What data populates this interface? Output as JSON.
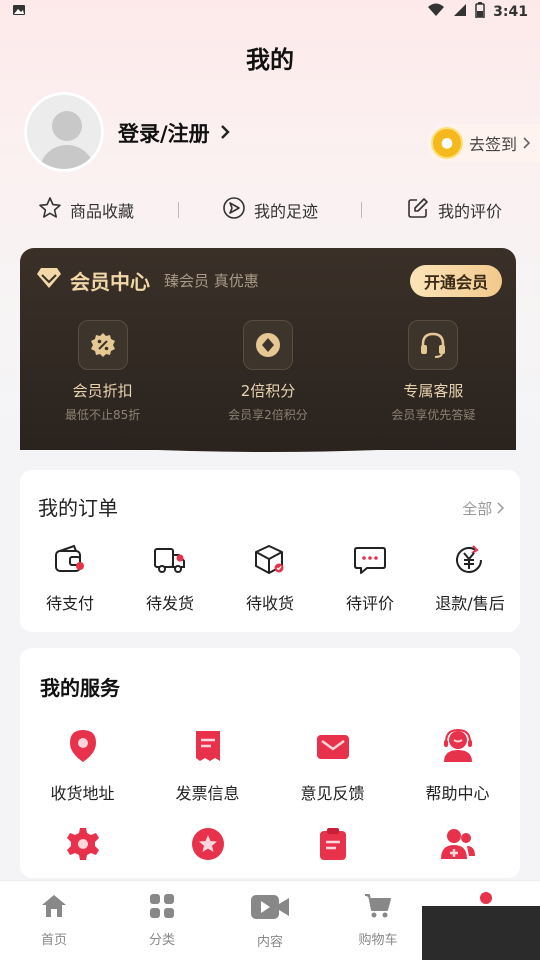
{
  "status_bar": {
    "time": "3:41"
  },
  "page_title": "我的",
  "profile": {
    "login_label": "登录/注册",
    "signin_label": "去签到"
  },
  "quick_links": [
    {
      "label": "商品收藏",
      "icon": "star-icon"
    },
    {
      "label": "我的足迹",
      "icon": "footprint-icon"
    },
    {
      "label": "我的评价",
      "icon": "edit-icon"
    }
  ],
  "vip": {
    "title": "会员中心",
    "slogan": "臻会员 真优惠",
    "open_label": "开通会员",
    "features": [
      {
        "title": "会员折扣",
        "desc": "最低不止85折",
        "icon": "discount-icon"
      },
      {
        "title": "2倍积分",
        "desc": "会员享2倍积分",
        "icon": "points-icon"
      },
      {
        "title": "专属客服",
        "desc": "会员享优先答疑",
        "icon": "headset-icon"
      }
    ],
    "colors": {
      "bg": "#2f2722",
      "gold": "#f2d7a8"
    }
  },
  "orders": {
    "title": "我的订单",
    "all_label": "全部",
    "items": [
      {
        "label": "待支付",
        "icon": "wallet-icon"
      },
      {
        "label": "待发货",
        "icon": "truck-icon"
      },
      {
        "label": "待收货",
        "icon": "package-icon"
      },
      {
        "label": "待评价",
        "icon": "comment-icon"
      },
      {
        "label": "退款/售后",
        "icon": "refund-icon"
      }
    ]
  },
  "services": {
    "title": "我的服务",
    "items": [
      {
        "label": "收货地址",
        "icon": "location-icon"
      },
      {
        "label": "发票信息",
        "icon": "invoice-icon"
      },
      {
        "label": "意见反馈",
        "icon": "mail-icon"
      },
      {
        "label": "帮助中心",
        "icon": "support-icon"
      },
      {
        "label": "",
        "icon": "settings-icon"
      },
      {
        "label": "",
        "icon": "star-badge-icon"
      },
      {
        "label": "",
        "icon": "clipboard-icon"
      },
      {
        "label": "",
        "icon": "users-icon"
      }
    ],
    "accent": "#e8314a"
  },
  "tabbar": {
    "tabs": [
      {
        "label": "首页",
        "icon": "home-icon"
      },
      {
        "label": "分类",
        "icon": "grid-icon"
      },
      {
        "label": "内容",
        "icon": "video-icon"
      },
      {
        "label": "购物车",
        "icon": "cart-icon"
      },
      {
        "label": "",
        "icon": "profile-icon"
      }
    ]
  }
}
